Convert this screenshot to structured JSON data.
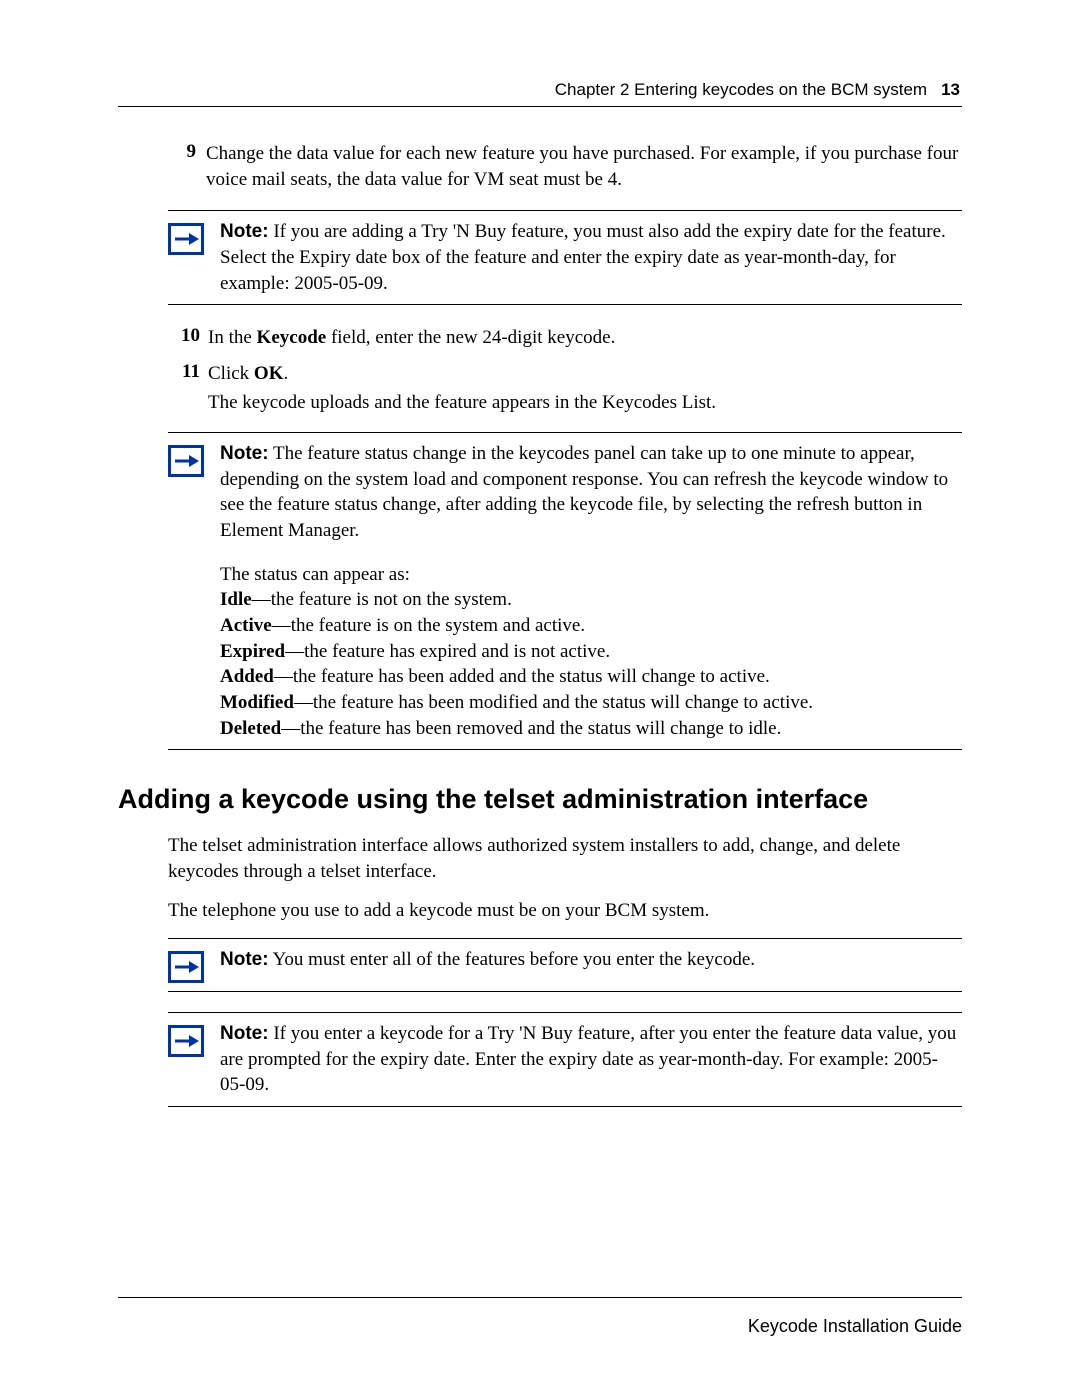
{
  "header": {
    "chapter": "Chapter 2  Entering keycodes on the BCM system",
    "page_num": "13"
  },
  "steps": {
    "s9": {
      "num": "9",
      "text": "Change the data value for each new feature you have purchased. For example, if you purchase four voice mail seats, the data value for VM seat must be 4."
    },
    "s10": {
      "num": "10",
      "prefix": "In the ",
      "bold1": "Keycode",
      "suffix": " field, enter the new 24-digit keycode."
    },
    "s11": {
      "num": "11",
      "prefix": "Click ",
      "bold1": "OK",
      "suffix": ".",
      "result": "The keycode uploads and the feature appears in the Keycodes List."
    }
  },
  "notes": {
    "label": "Note:",
    "n1": " If you are adding a Try 'N Buy feature, you must also add the expiry date for the feature. Select the Expiry date box of the feature and enter the expiry date as year-month-day, for example: 2005-05-09.",
    "n2": "  The feature status change in the keycodes panel can take up to one minute to appear, depending on the system load and component response. You can refresh the keycode window to see the feature status change, after adding the keycode file, by selecting the refresh button in Element Manager.",
    "n3": " You must enter all of the features before you enter the keycode.",
    "n4": " If you enter a keycode for a Try 'N Buy feature, after you enter the feature data value, you are prompted for the expiry date. Enter the expiry date as year-month-day. For example: 2005-05-09."
  },
  "status_section": {
    "intro": "The status can appear as:",
    "items": [
      {
        "term": "Idle",
        "desc": "—the feature is not on the system."
      },
      {
        "term": "Active",
        "desc": "—the feature is on the system and active."
      },
      {
        "term": "Expired",
        "desc": "—the feature has expired and is not active."
      },
      {
        "term": "Added",
        "desc": "—the feature has been added and the status will change to active."
      },
      {
        "term": "Modified",
        "desc": "—the feature has been modified and the status will change to active."
      },
      {
        "term": "Deleted",
        "desc": "—the feature has been removed and the status will change to idle."
      }
    ]
  },
  "section_heading": "Adding a keycode using the telset administration interface",
  "section_para1": "The telset administration interface allows authorized system installers to add, change, and delete keycodes through a telset interface.",
  "section_para2": "The telephone you use to add a keycode must be on your BCM system.",
  "footer": "Keycode Installation Guide"
}
